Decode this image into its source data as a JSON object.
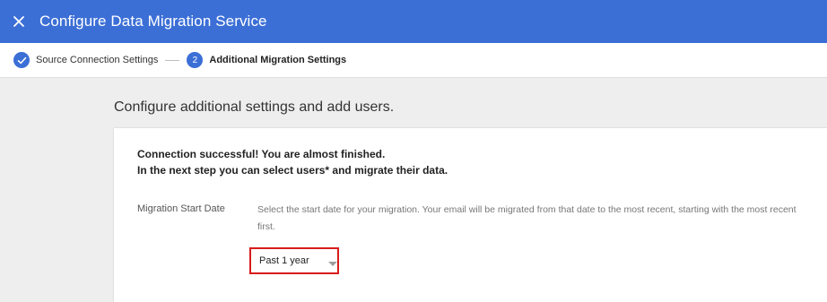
{
  "window": {
    "title": "Configure Data Migration Service"
  },
  "stepper": {
    "steps": [
      {
        "label": "Source Connection Settings",
        "state": "completed"
      },
      {
        "number": "2",
        "label": "Additional Migration Settings",
        "state": "active"
      }
    ]
  },
  "main": {
    "heading": "Configure additional settings and add users.",
    "message_line1": "Connection successful! You are almost finished.",
    "message_line2": "In the next step you can select users* and migrate their data.",
    "migration_start_date": {
      "label": "Migration Start Date",
      "description": "Select the start date for your migration. Your email will be migrated from that date to the most recent, starting with the most recent first.",
      "selected": "Past 1 year"
    }
  },
  "colors": {
    "header_bg": "#3c6fd6",
    "accent": "#3c6fd6",
    "highlight_border": "#d81b1b"
  },
  "icons": {
    "close": "close-icon",
    "step_done": "checkmark-icon",
    "dropdown": "dropdown-arrow-icon"
  }
}
